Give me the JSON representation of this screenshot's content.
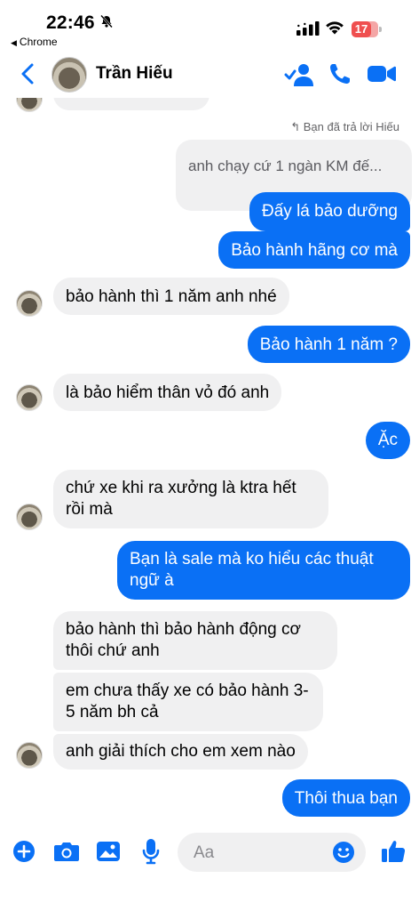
{
  "status": {
    "time": "22:46",
    "back_app": "Chrome",
    "battery": "17"
  },
  "header": {
    "contact_name": "Trần Hiếu"
  },
  "reply_note": "Bạn đã trả lời Hiếu",
  "messages": [
    {
      "dir": "out-replied",
      "text": "anh chạy cứ 1 ngàn KM đế..."
    },
    {
      "dir": "out",
      "text": "Đấy lá bảo dưỡng"
    },
    {
      "dir": "out",
      "text": "Bảo hành hãng cơ mà"
    },
    {
      "dir": "in",
      "text": "bảo hành thì 1 năm anh nhé"
    },
    {
      "dir": "out",
      "text": "Bảo hành 1 năm ?"
    },
    {
      "dir": "in",
      "text": "là bảo hiểm thân vỏ đó anh"
    },
    {
      "dir": "out",
      "text": "Ặc"
    },
    {
      "dir": "in",
      "text": "chứ xe khi ra xưởng là ktra hết rồi mà"
    },
    {
      "dir": "out",
      "text": "Bạn là sale mà ko hiểu các thuật ngữ à"
    },
    {
      "dir": "in",
      "text": "bảo hành thì bảo hành động cơ thôi chứ anh"
    },
    {
      "dir": "in",
      "text": "em chưa thấy xe có bảo hành 3-5 năm bh cả"
    },
    {
      "dir": "in",
      "text": "anh giải thích cho em xem nào"
    },
    {
      "dir": "out",
      "text": "Thôi thua bạn"
    }
  ],
  "composer": {
    "placeholder": "Aa"
  },
  "icons": [
    "back-icon",
    "video-call-icon",
    "phone-icon",
    "add-person-icon",
    "plus-icon",
    "camera-icon",
    "gallery-icon",
    "mic-icon",
    "emoji-icon",
    "like-icon",
    "bell-slash-icon",
    "signal-icon",
    "wifi-icon"
  ],
  "colors": {
    "accent": "#0a70f5",
    "incoming_bubble": "#f0f0f1"
  }
}
